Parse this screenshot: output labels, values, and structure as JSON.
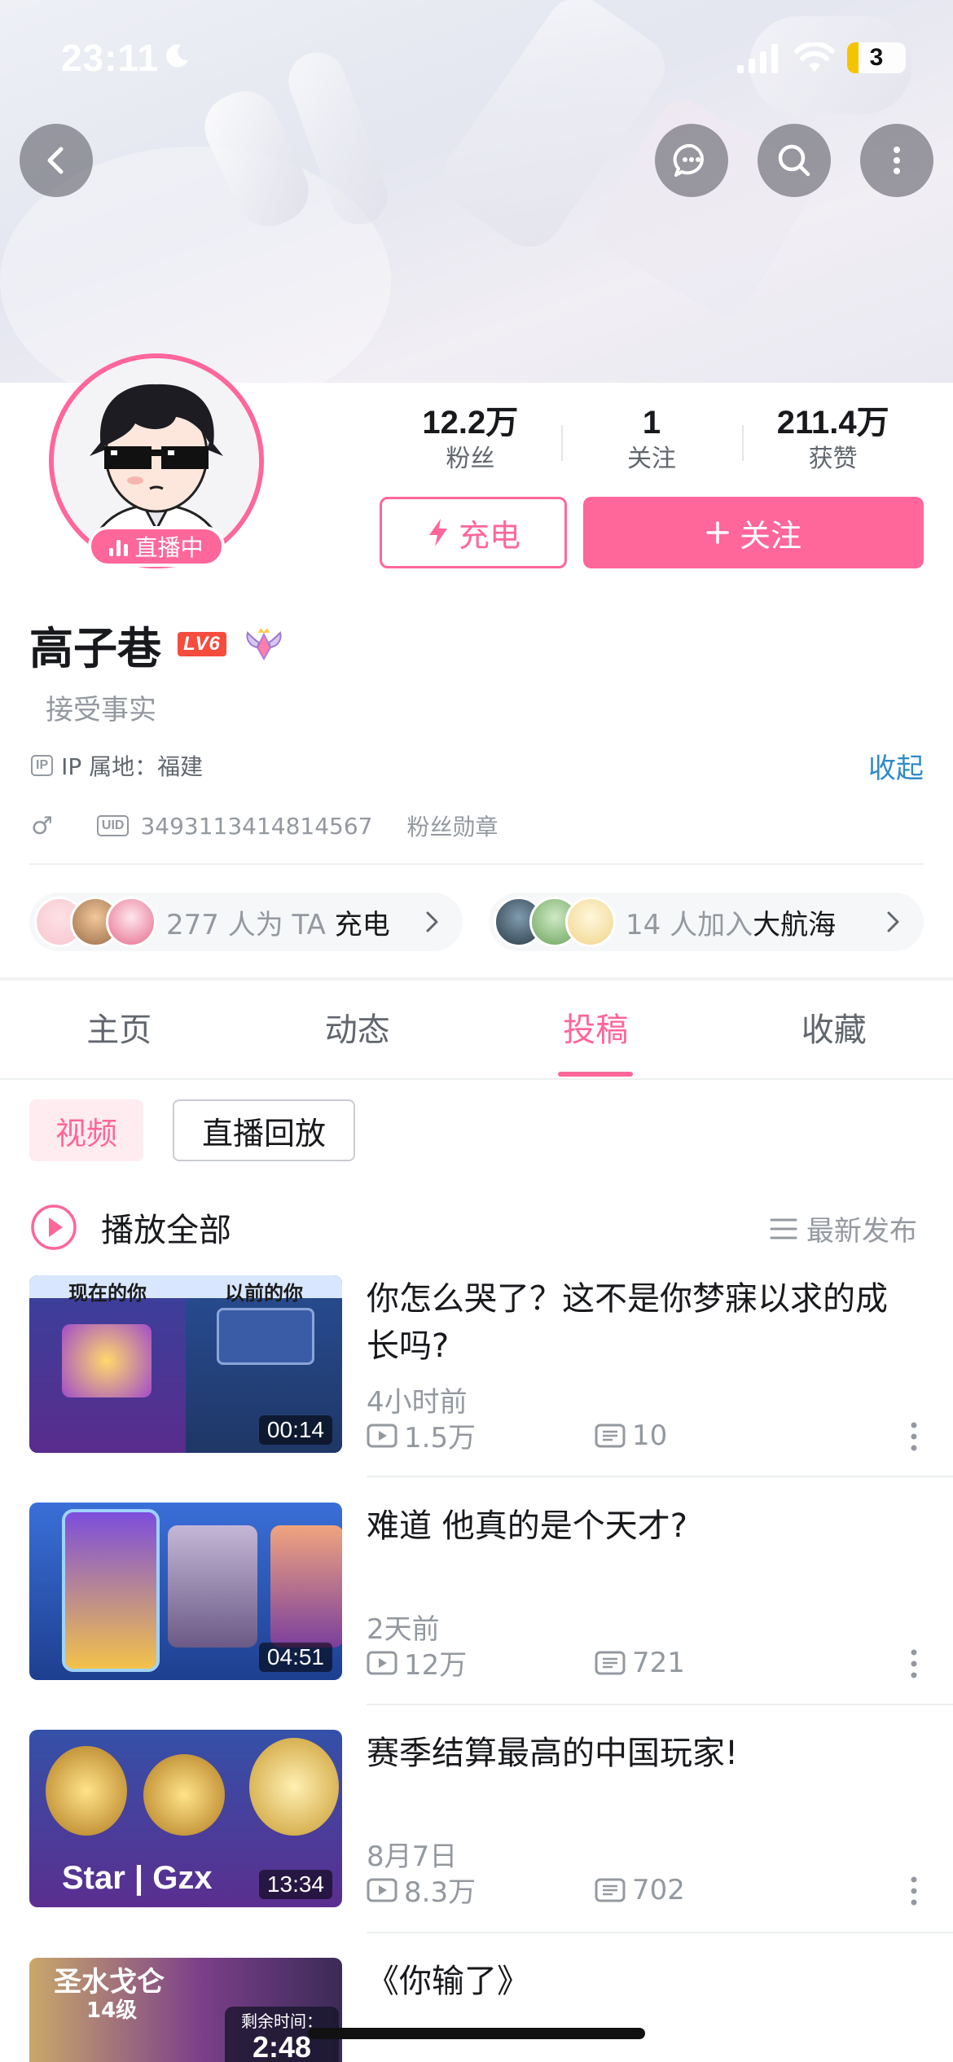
{
  "status_bar": {
    "time": "23:11",
    "battery": "3"
  },
  "profile": {
    "live_label": "直播中",
    "stats": [
      {
        "value": "12.2万",
        "label": "粉丝"
      },
      {
        "value": "1",
        "label": "关注"
      },
      {
        "value": "211.4万",
        "label": "获赞"
      }
    ],
    "charge_label": "充电",
    "follow_label": "关注",
    "name": "高子巷",
    "level": "LV6",
    "signature": "接受事实",
    "ip_badge": "IP",
    "ip_text": "IP 属地：福建",
    "collapse_label": "收起",
    "gender": "♂",
    "uid_badge": "UID",
    "uid": "3493113414814567",
    "fan_medal_label": "粉丝勋章"
  },
  "support": {
    "charge_count": "277 人为 TA",
    "charge_word": "充电",
    "crew_count": "14 人加入",
    "crew_word": "大航海"
  },
  "tabs": [
    "主页",
    "动态",
    "投稿",
    "收藏"
  ],
  "active_tab": "投稿",
  "sub_tabs": [
    "视频",
    "直播回放"
  ],
  "play_all_label": "播放全部",
  "sort_label": "最新发布",
  "videos": [
    {
      "title": "你怎么哭了？这不是你梦寐以求的成长吗?",
      "date": "4小时前",
      "views": "1.5万",
      "comments": "10",
      "duration": "00:14"
    },
    {
      "title": "难道 他真的是个天才?",
      "date": "2天前",
      "views": "12万",
      "comments": "721",
      "duration": "04:51"
    },
    {
      "title": "赛季结算最高的中国玩家!",
      "date": "8月7日",
      "views": "8.3万",
      "comments": "702",
      "duration": "13:34"
    },
    {
      "title": "《你输了》",
      "date": "",
      "views": "",
      "comments": "",
      "duration": ""
    }
  ],
  "thumb_text": {
    "v1_left": "现在的你",
    "v1_right": "以前的你",
    "v3_text": "Star | Gzx",
    "v4_text": "圣水戈仑",
    "v4_sub": "14级",
    "v4_timer_label": "剩余时间：",
    "v4_timer": "2:48"
  },
  "colors": {
    "accent": "#ff6699",
    "link": "#2f8bc6",
    "muted": "#9499a0"
  }
}
